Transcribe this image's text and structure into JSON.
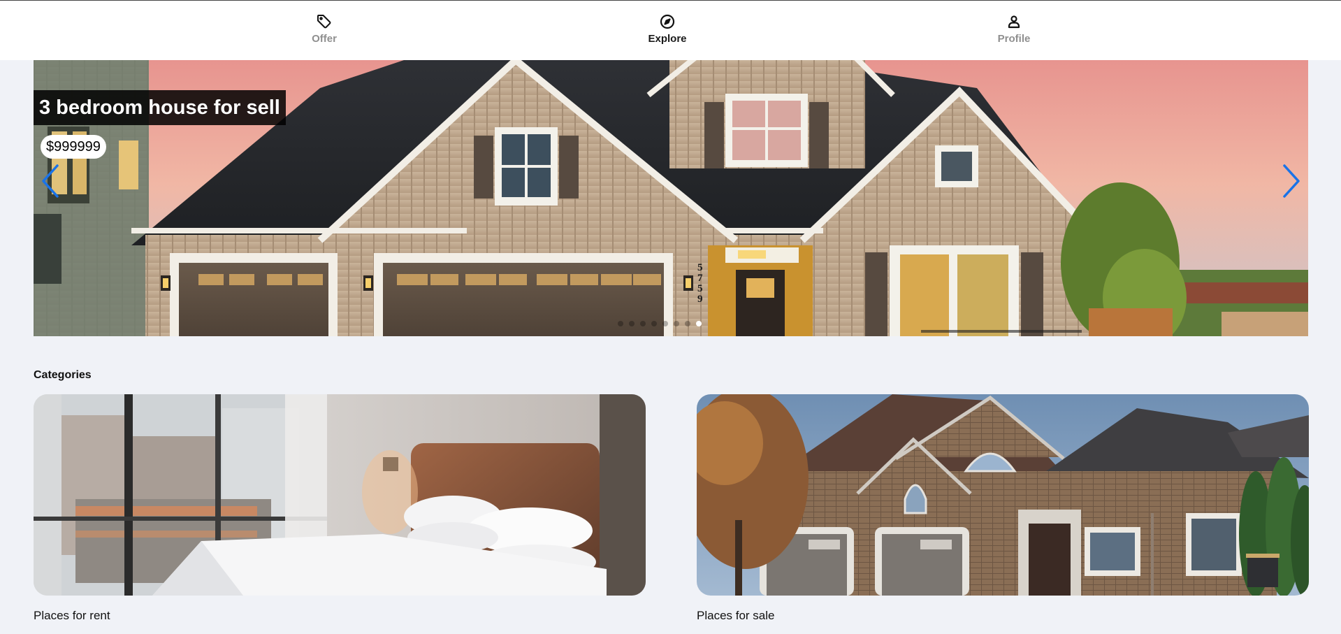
{
  "nav": {
    "items": [
      {
        "label": "Offer",
        "icon": "tag-icon",
        "active": false
      },
      {
        "label": "Explore",
        "icon": "compass-icon",
        "active": true
      },
      {
        "label": "Profile",
        "icon": "person-icon",
        "active": false
      }
    ]
  },
  "hero": {
    "title": "3 bedroom house for sell",
    "price": "$999999",
    "house_number": "5759",
    "slide_count": 8,
    "active_slide": 8,
    "arrow_color": "#1a73e8"
  },
  "categories": {
    "heading": "Categories",
    "items": [
      {
        "label": "Places for rent",
        "image": "bedroom-photo"
      },
      {
        "label": "Places for sale",
        "image": "brick-house-photo"
      }
    ]
  }
}
